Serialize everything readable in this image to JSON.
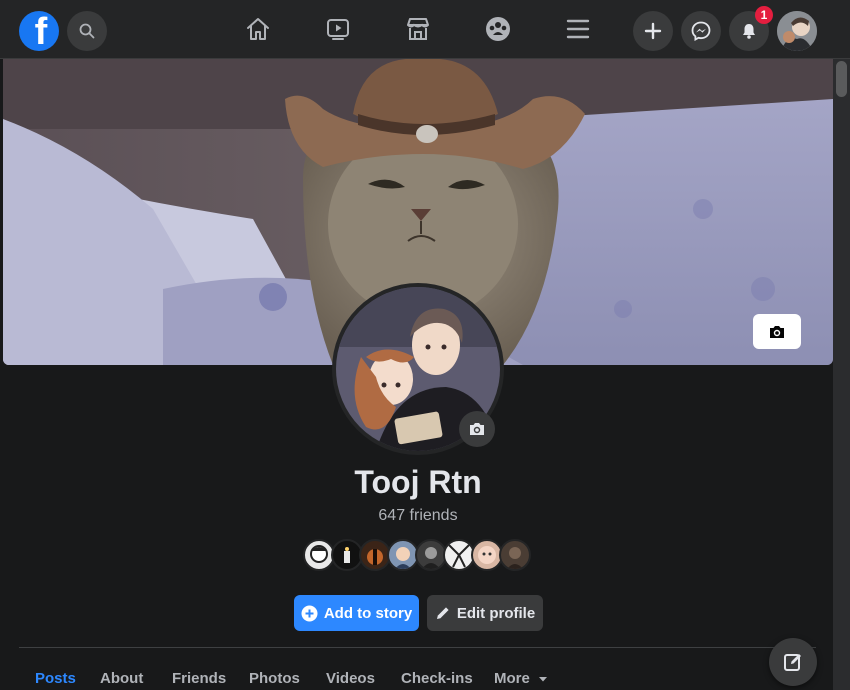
{
  "topbar": {
    "logo_letter": "f",
    "notification_count": "1"
  },
  "profile": {
    "name": "Tooj Rtn",
    "friends": "647 friends"
  },
  "actions": {
    "add_story": "Add to story",
    "edit_profile": "Edit profile"
  },
  "tabs": [
    {
      "label": "Posts",
      "active": true
    },
    {
      "label": "About"
    },
    {
      "label": "Friends"
    },
    {
      "label": "Photos"
    },
    {
      "label": "Videos"
    },
    {
      "label": "Check-ins"
    },
    {
      "label": "More"
    }
  ],
  "colors": {
    "accent": "#2d88ff",
    "background": "#18191a",
    "surface": "#242526",
    "badge": "#e41e3f"
  },
  "icons": [
    "search-icon",
    "home-icon",
    "watch-icon",
    "marketplace-icon",
    "groups-icon",
    "menu-icon",
    "plus-icon",
    "messenger-icon",
    "bell-icon",
    "camera-icon",
    "pencil-icon",
    "compose-icon",
    "caret-down-icon"
  ]
}
